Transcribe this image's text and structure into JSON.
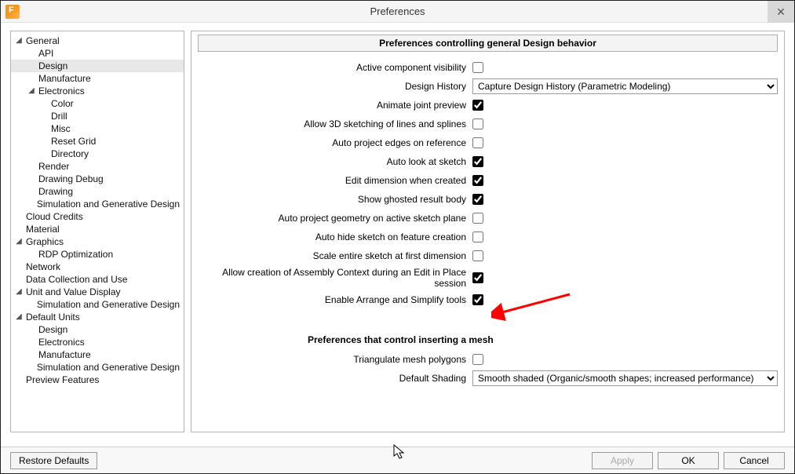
{
  "window": {
    "title": "Preferences"
  },
  "tree": {
    "nodes": [
      {
        "label": "General",
        "expand": true,
        "children": [
          {
            "label": "API"
          },
          {
            "label": "Design",
            "selected": true
          },
          {
            "label": "Manufacture"
          },
          {
            "label": "Electronics",
            "expand": true,
            "children": [
              {
                "label": "Color"
              },
              {
                "label": "Drill"
              },
              {
                "label": "Misc"
              },
              {
                "label": "Reset Grid"
              },
              {
                "label": "Directory"
              }
            ]
          },
          {
            "label": "Render"
          },
          {
            "label": "Drawing Debug"
          },
          {
            "label": "Drawing"
          },
          {
            "label": "Simulation and Generative Design"
          }
        ]
      },
      {
        "label": "Cloud Credits"
      },
      {
        "label": "Material"
      },
      {
        "label": "Graphics",
        "expand": true,
        "children": [
          {
            "label": "RDP Optimization"
          }
        ]
      },
      {
        "label": "Network"
      },
      {
        "label": "Data Collection and Use"
      },
      {
        "label": "Unit and Value Display",
        "expand": true,
        "children": [
          {
            "label": "Simulation and Generative Design"
          }
        ]
      },
      {
        "label": "Default Units",
        "expand": true,
        "children": [
          {
            "label": "Design"
          },
          {
            "label": "Electronics"
          },
          {
            "label": "Manufacture"
          },
          {
            "label": "Simulation and Generative Design"
          }
        ]
      },
      {
        "label": "Preview Features"
      }
    ]
  },
  "main": {
    "section1_title": "Preferences controlling general Design behavior",
    "rows1": [
      {
        "label": "Active component visibility",
        "type": "checkbox",
        "value": false
      },
      {
        "label": "Design History",
        "type": "select",
        "value": "Capture Design History (Parametric Modeling)"
      },
      {
        "label": "Animate joint preview",
        "type": "checkbox",
        "value": true
      },
      {
        "label": "Allow 3D sketching of lines and splines",
        "type": "checkbox",
        "value": false
      },
      {
        "label": "Auto project edges on reference",
        "type": "checkbox",
        "value": false
      },
      {
        "label": "Auto look at sketch",
        "type": "checkbox",
        "value": true
      },
      {
        "label": "Edit dimension when created",
        "type": "checkbox",
        "value": true
      },
      {
        "label": "Show ghosted result body",
        "type": "checkbox",
        "value": true
      },
      {
        "label": "Auto project geometry on active sketch plane",
        "type": "checkbox",
        "value": false
      },
      {
        "label": "Auto hide sketch on feature creation",
        "type": "checkbox",
        "value": false
      },
      {
        "label": "Scale entire sketch at first dimension",
        "type": "checkbox",
        "value": false
      },
      {
        "label": "Allow creation of Assembly Context during an Edit in Place session",
        "type": "checkbox",
        "value": true
      },
      {
        "label": "Enable Arrange and Simplify tools",
        "type": "checkbox",
        "value": true
      }
    ],
    "section2_title": "Preferences that control inserting a mesh",
    "rows2": [
      {
        "label": "Triangulate mesh polygons",
        "type": "checkbox",
        "value": false
      },
      {
        "label": "Default Shading",
        "type": "select",
        "value": "Smooth shaded (Organic/smooth shapes; increased performance)"
      }
    ]
  },
  "footer": {
    "restore": "Restore Defaults",
    "apply": "Apply",
    "ok": "OK",
    "cancel": "Cancel"
  }
}
